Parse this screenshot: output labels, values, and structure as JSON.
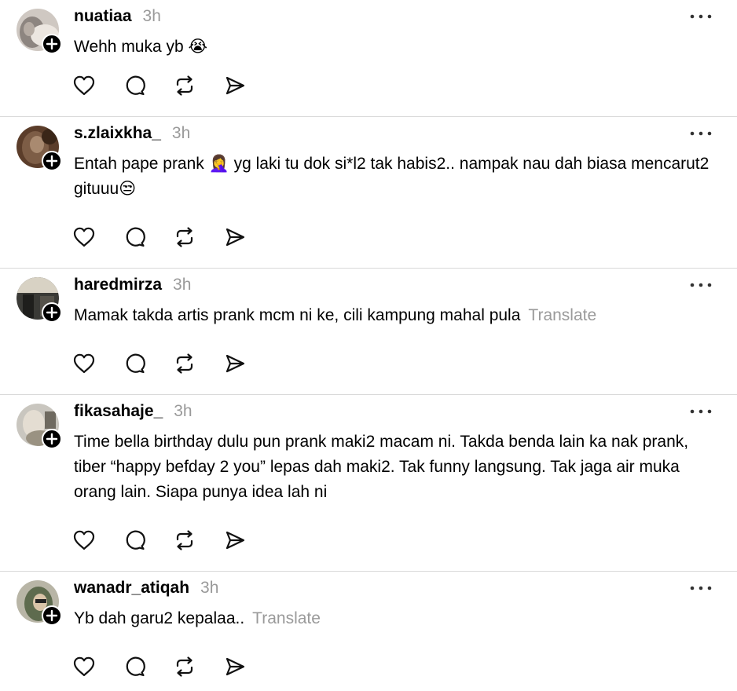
{
  "posts": [
    {
      "username": "nuatiaa",
      "time": "3h",
      "text": "Wehh muka yb 😭",
      "translate": ""
    },
    {
      "username": "s.zlaixkha_",
      "time": "3h",
      "text": "Entah pape prank 🤦‍♀️ yg laki tu dok si*l2 tak habis2.. nampak nau dah biasa mencarut2 gituuu😒",
      "translate": ""
    },
    {
      "username": "haredmirza",
      "time": "3h",
      "text": "Mamak takda artis prank mcm ni ke, cili kampung mahal pula",
      "translate": "Translate"
    },
    {
      "username": "fikasahaje_",
      "time": "3h",
      "text": "Time bella birthday dulu pun prank maki2 macam ni. Takda benda lain ka nak prank, tiber “happy befday 2 you” lepas dah maki2. Tak funny langsung. Tak jaga air muka orang lain. Siapa punya idea lah ni",
      "translate": ""
    },
    {
      "username": "wanadr_atiqah",
      "time": "3h",
      "text": "Yb dah garu2 kepalaa..",
      "translate": "Translate"
    }
  ],
  "icons": {
    "like": "heart-icon",
    "reply": "comment-bubble-icon",
    "repost": "repost-icon",
    "share": "send-icon",
    "more": "more-dots-icon",
    "follow": "plus-icon"
  },
  "colors": {
    "text": "#000000",
    "muted": "#9a9a9a",
    "divider": "#d9d9d9",
    "badge": "#000000"
  }
}
